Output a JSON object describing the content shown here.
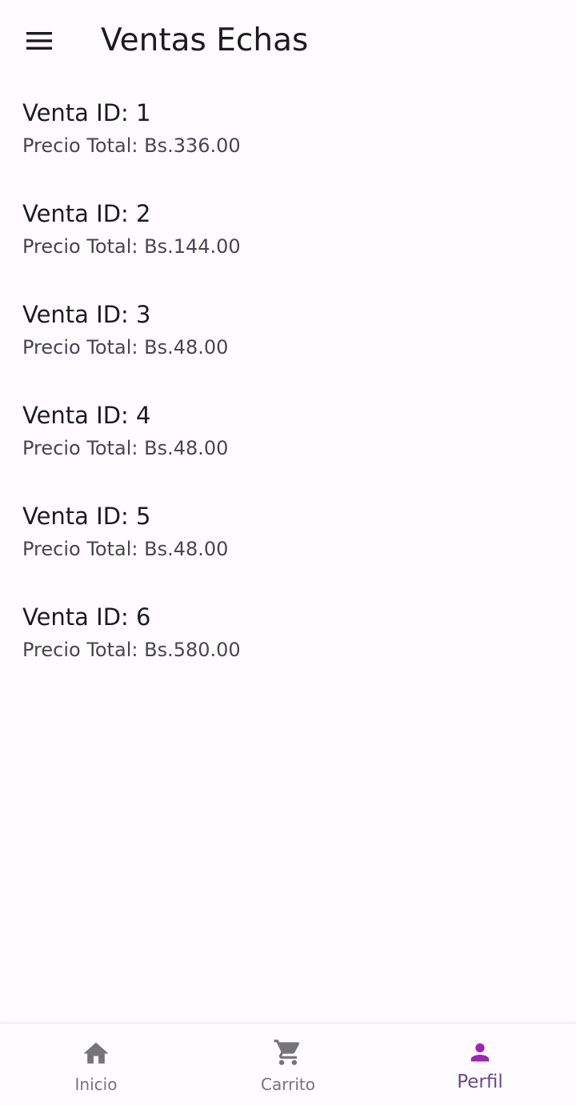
{
  "app_bar": {
    "title": "Ventas Echas",
    "menu_icon": "menu-icon"
  },
  "sales": [
    {
      "title": "Venta ID: 1",
      "subtitle": "Precio Total: Bs.336.00"
    },
    {
      "title": "Venta ID: 2",
      "subtitle": "Precio Total: Bs.144.00"
    },
    {
      "title": "Venta ID: 3",
      "subtitle": "Precio Total: Bs.48.00"
    },
    {
      "title": "Venta ID: 4",
      "subtitle": "Precio Total: Bs.48.00"
    },
    {
      "title": "Venta ID: 5",
      "subtitle": "Precio Total: Bs.48.00"
    },
    {
      "title": "Venta ID: 6",
      "subtitle": "Precio Total: Bs.580.00"
    }
  ],
  "bottom_nav": {
    "items": [
      {
        "label": "Inicio",
        "icon": "home-icon",
        "active": false
      },
      {
        "label": "Carrito",
        "icon": "cart-icon",
        "active": false
      },
      {
        "label": "Perfil",
        "icon": "person-icon",
        "active": true
      }
    ],
    "active_color": "#9c27b0",
    "inactive_color": "#757575"
  },
  "colors": {
    "background": "#fffbfe",
    "text_primary": "#1c1b1f",
    "text_secondary": "#49454f"
  }
}
